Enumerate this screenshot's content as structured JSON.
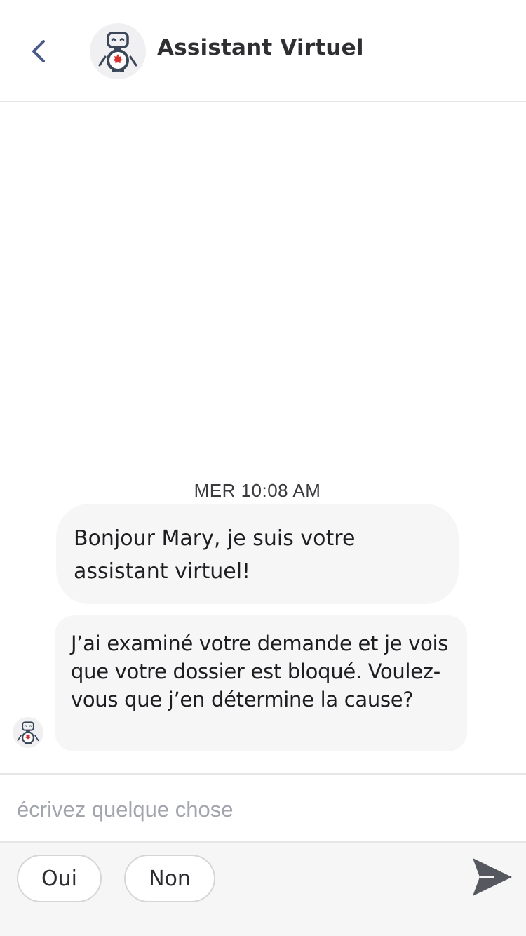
{
  "header": {
    "title": "Assistant Virtuel",
    "back_icon": "chevron-left-icon",
    "avatar_icon": "robot-maple-leaf-icon"
  },
  "chat": {
    "timestamp": "MER 10:08 AM",
    "messages": [
      {
        "sender": "bot",
        "text": "Bonjour Mary, je suis votre assistant virtuel!"
      },
      {
        "sender": "bot",
        "text": "J’ai examiné votre demande et je vois que votre dossier est bloqué. Voulez-vous que j’en détermine la cause?"
      }
    ]
  },
  "composer": {
    "placeholder": "écrivez quelque chose",
    "value": "",
    "send_icon": "send-icon"
  },
  "quick_replies": [
    {
      "label": "Oui"
    },
    {
      "label": "Non"
    }
  ],
  "colors": {
    "accent": "#4a5a8a",
    "bubble_bg": "#f6f6f7",
    "quick_bar_bg": "#f6f6f7",
    "robot_dark": "#3b4658",
    "maple_red": "#d63031",
    "send_icon": "#55585f"
  }
}
